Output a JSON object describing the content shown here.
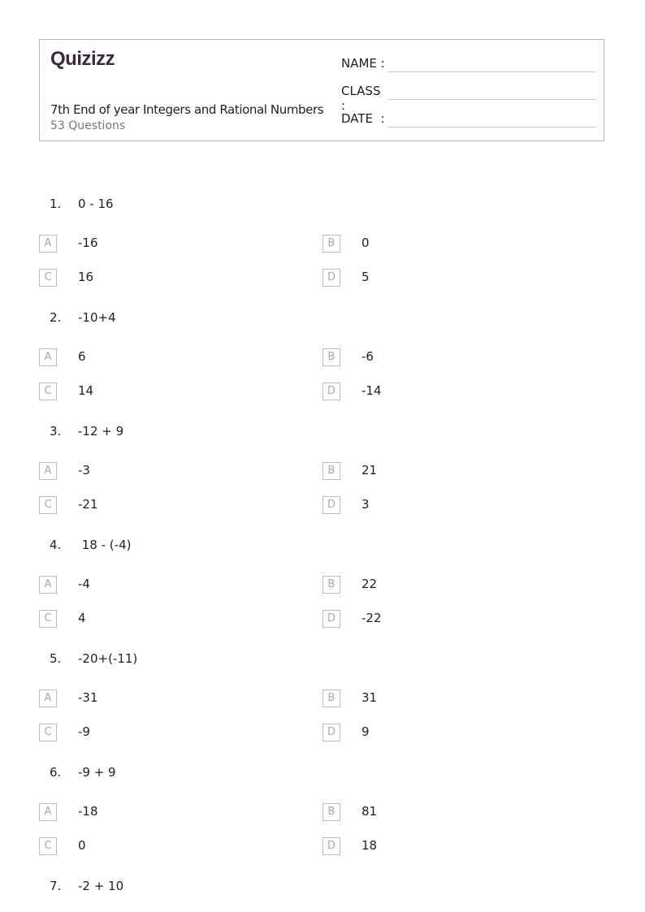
{
  "header": {
    "logo": "Quizizz",
    "title": "7th End of year Integers and Rational Numbers",
    "question_count": "53 Questions",
    "fields": [
      {
        "label": "NAME :"
      },
      {
        "label": "CLASS :"
      },
      {
        "label": "DATE  :"
      }
    ]
  },
  "questions": [
    {
      "number": "1.",
      "text": "0 - 16",
      "options": [
        {
          "letter": "A",
          "value": "-16"
        },
        {
          "letter": "B",
          "value": "0"
        },
        {
          "letter": "C",
          "value": "16"
        },
        {
          "letter": "D",
          "value": "5"
        }
      ]
    },
    {
      "number": "2.",
      "text": "-10+4",
      "options": [
        {
          "letter": "A",
          "value": "6"
        },
        {
          "letter": "B",
          "value": "-6"
        },
        {
          "letter": "C",
          "value": "14"
        },
        {
          "letter": "D",
          "value": "-14"
        }
      ]
    },
    {
      "number": "3.",
      "text": "-12 + 9",
      "options": [
        {
          "letter": "A",
          "value": "-3"
        },
        {
          "letter": "B",
          "value": "21"
        },
        {
          "letter": "C",
          "value": "-21"
        },
        {
          "letter": "D",
          "value": "3"
        }
      ]
    },
    {
      "number": "4.",
      "text": " 18 - (-4)",
      "options": [
        {
          "letter": "A",
          "value": "-4"
        },
        {
          "letter": "B",
          "value": "22"
        },
        {
          "letter": "C",
          "value": "4"
        },
        {
          "letter": "D",
          "value": "-22"
        }
      ]
    },
    {
      "number": "5.",
      "text": "-20+(-11)",
      "options": [
        {
          "letter": "A",
          "value": "-31"
        },
        {
          "letter": "B",
          "value": "31"
        },
        {
          "letter": "C",
          "value": "-9"
        },
        {
          "letter": "D",
          "value": "9"
        }
      ]
    },
    {
      "number": "6.",
      "text": "-9 + 9",
      "options": [
        {
          "letter": "A",
          "value": "-18"
        },
        {
          "letter": "B",
          "value": "81"
        },
        {
          "letter": "C",
          "value": "0"
        },
        {
          "letter": "D",
          "value": "18"
        }
      ]
    },
    {
      "number": "7.",
      "text": "-2 + 10",
      "options": []
    }
  ]
}
